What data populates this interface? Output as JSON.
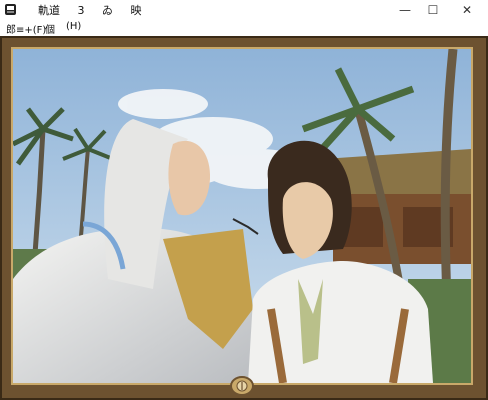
{
  "window": {
    "app_icon": "game-icon",
    "title_parts": [
      "軌道",
      "3",
      "ゐ",
      "映"
    ],
    "minimize_glyph": "—",
    "maximize_glyph": "☐",
    "close_glyph": "✕"
  },
  "menu": {
    "file": "郎≡+(F)",
    "edit": "個",
    "help": "(H)"
  },
  "scene": {
    "description_icon": "visual-novel-scene",
    "colors": {
      "frame": "#6d5230",
      "frame_gold": "#c9a96a",
      "sky": "#a9c7e4"
    }
  }
}
